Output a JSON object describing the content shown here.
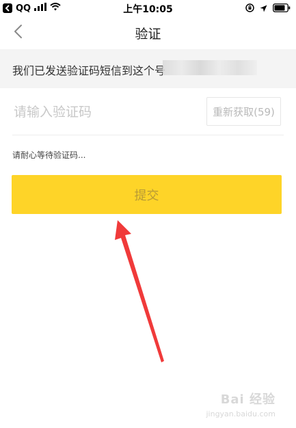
{
  "status_bar": {
    "app_name": "QQ",
    "time": "上午10:05"
  },
  "nav": {
    "title": "验证"
  },
  "info": {
    "message": "我们已发送验证码短信到这个号"
  },
  "code_input": {
    "value": "",
    "placeholder": "请输入验证码"
  },
  "resend": {
    "label": "重新获取(59)"
  },
  "hint": {
    "text": "请耐心等待验证码..."
  },
  "submit": {
    "label": "提交"
  },
  "watermark": {
    "text": "Bai 经验",
    "sub": "jingyan.baidu.com"
  },
  "colors": {
    "accent": "#fed428",
    "annotation_arrow": "#f03a3a"
  }
}
